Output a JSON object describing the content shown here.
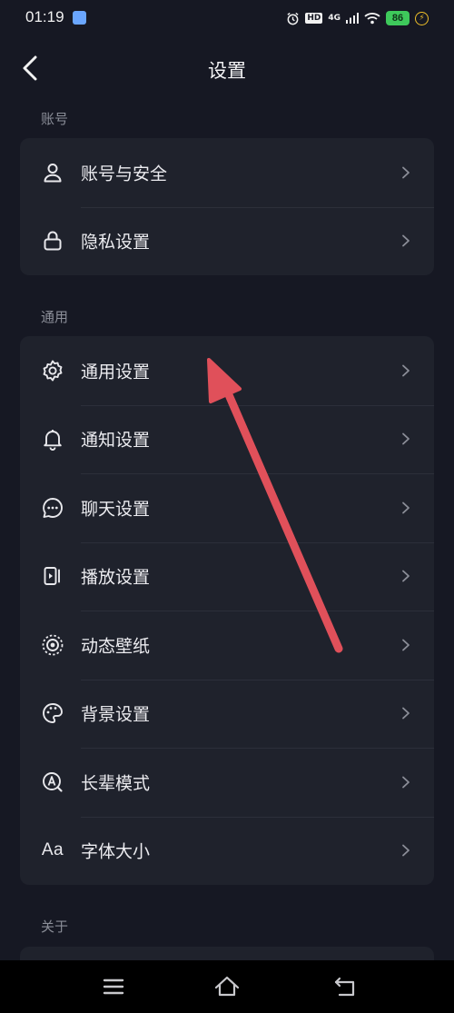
{
  "status_bar": {
    "time": "01:19",
    "hd_label": "HD",
    "network_label": "4G",
    "battery_level": "86"
  },
  "header": {
    "title": "设置"
  },
  "sections": {
    "account": {
      "label": "账号",
      "items": [
        {
          "label": "账号与安全",
          "icon": "person-icon"
        },
        {
          "label": "隐私设置",
          "icon": "lock-icon"
        }
      ]
    },
    "general": {
      "label": "通用",
      "items": [
        {
          "label": "通用设置",
          "icon": "gear-icon"
        },
        {
          "label": "通知设置",
          "icon": "bell-icon"
        },
        {
          "label": "聊天设置",
          "icon": "chat-bubble-icon"
        },
        {
          "label": "播放设置",
          "icon": "play-screen-icon"
        },
        {
          "label": "动态壁纸",
          "icon": "live-wallpaper-icon"
        },
        {
          "label": "背景设置",
          "icon": "palette-icon"
        },
        {
          "label": "长辈模式",
          "icon": "elder-mode-icon"
        },
        {
          "label": "字体大小",
          "icon": "font-size-icon",
          "icon_text": "Aa"
        }
      ]
    },
    "about": {
      "label": "关于"
    }
  },
  "colors": {
    "background": "#161823",
    "card": "#1f222c",
    "annotation_arrow": "#e0505a",
    "battery": "#3ec95b"
  }
}
